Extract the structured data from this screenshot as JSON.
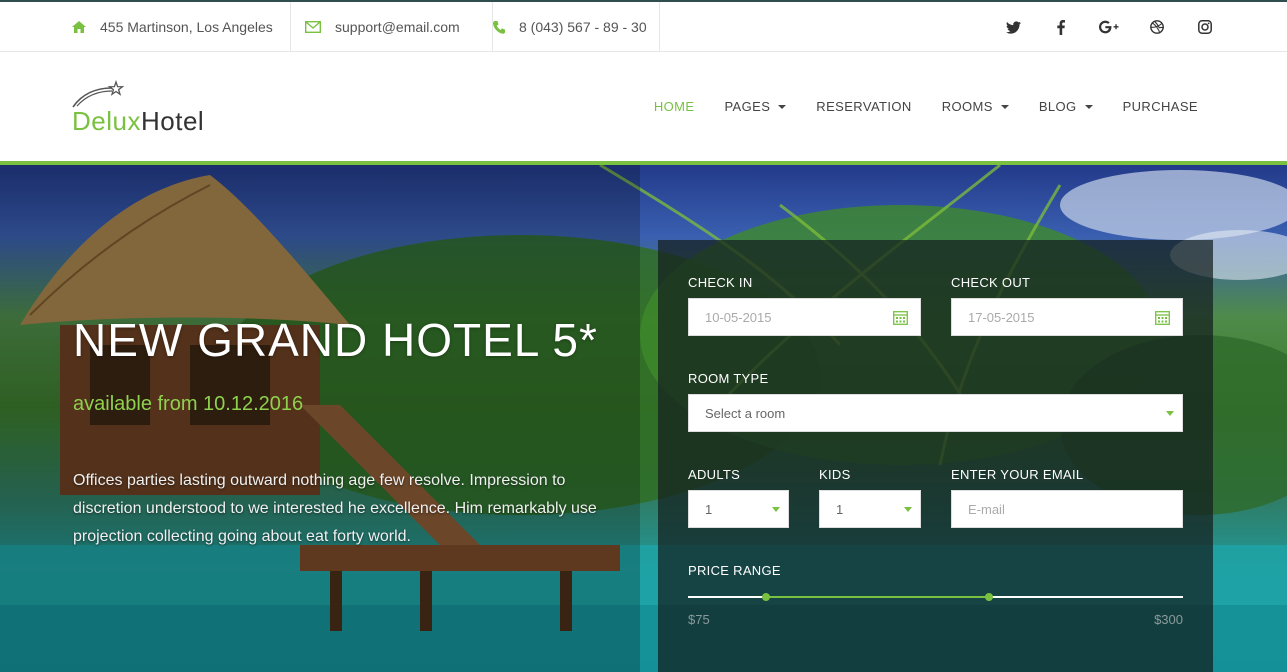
{
  "topbar": {
    "address": "455 Martinson, Los Angeles",
    "email": "support@email.com",
    "phone": "8 (043) 567 - 89 - 30",
    "social": [
      "twitter-icon",
      "facebook-icon",
      "google-plus-icon",
      "dribbble-icon",
      "instagram-icon"
    ]
  },
  "brand": {
    "part1": "Delux",
    "part2": "Hotel",
    "accent": "#7ac142"
  },
  "nav": {
    "home": "HOME",
    "pages": "PAGES",
    "reservation": "RESERVATION",
    "rooms": "ROOMS",
    "blog": "BLOG",
    "purchase": "PURCHASE"
  },
  "hero": {
    "title": "NEW GRAND HOTEL 5*",
    "subtitle": "available from 10.12.2016",
    "description": "Offices parties lasting outward nothing age few resolve. Impression to discretion understood to we interested he excellence. Him remarkably use projection collecting going about eat forty world."
  },
  "booking": {
    "check_in_label": "CHECK IN",
    "check_in_value": "10-05-2015",
    "check_out_label": "CHECK OUT",
    "check_out_value": "17-05-2015",
    "room_type_label": "ROOM TYPE",
    "room_type_value": "Select a room",
    "adults_label": "ADULTS",
    "adults_value": "1",
    "kids_label": "KIDS",
    "kids_value": "1",
    "email_label": "ENTER YOUR EMAIL",
    "email_placeholder": "E-mail",
    "price_label": "PRICE RANGE",
    "price_min": "$75",
    "price_max": "$300"
  }
}
